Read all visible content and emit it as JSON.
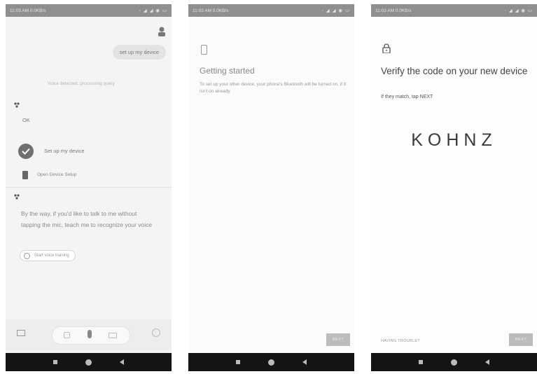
{
  "phones": [
    {
      "status": {
        "time": "11:03 AM 0.0KB/s",
        "icons": "◦ ◢ ◢ ◉ ▭"
      },
      "user_message": "set up my device",
      "faint_note": "Voice detected, processing query",
      "assistant_reply": "OK",
      "setup_card": "Set up my device",
      "device_setup_link": "Open Device Setup",
      "byway_message": "By the way, if you'd like to talk to me without tapping the mic, teach me to recognize your voice",
      "chip_label": "Start voice training",
      "icons": [
        "assistant-avatar-icon",
        "check-icon",
        "phone-icon",
        "keyboard-icon",
        "camera-icon",
        "mic-icon",
        "explore-icon"
      ]
    },
    {
      "status": {
        "time": "11:03 AM 0.0KB/s",
        "icons": "◦ ◢ ◢ ◉ ▭"
      },
      "title": "Getting started",
      "body": "To set up your other device, your phone's Bluetooth will be turned on, if it isn't on already.",
      "next_label": "NEXT"
    },
    {
      "status": {
        "time": "11:03 AM 0.0KB/s",
        "icons": "◦ ◢ ◢ ◉ ▭"
      },
      "title": "Verify the code on your new device",
      "subtitle": "If they match, tap NEXT",
      "code": "KOHNZ",
      "link": "HAVING TROUBLE?",
      "next_label": "NEXT"
    }
  ]
}
